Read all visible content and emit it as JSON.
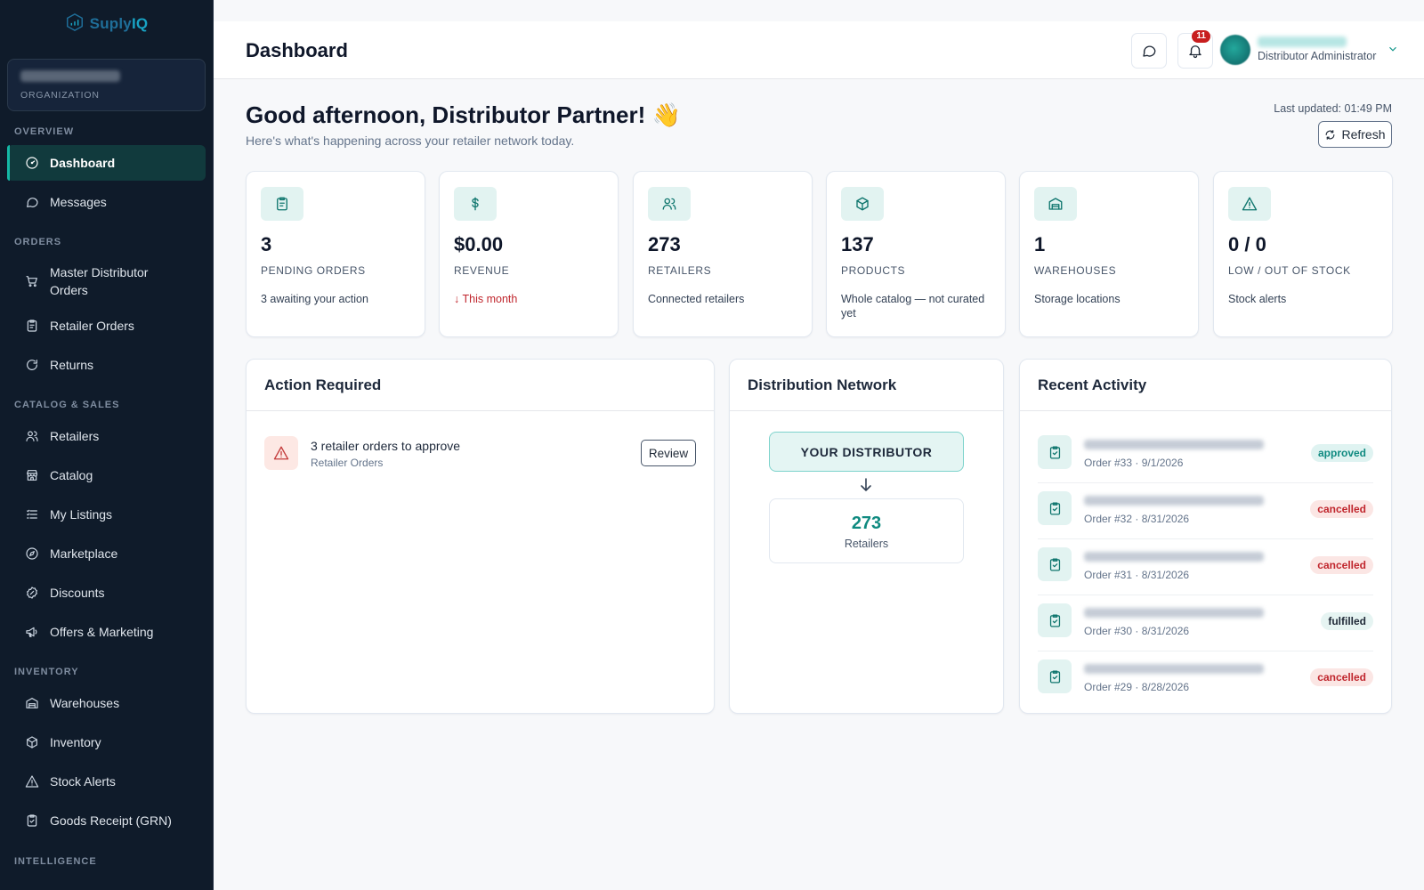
{
  "brand": {
    "name_a": "Suply",
    "name_b": "IQ"
  },
  "organization": {
    "label": "ORGANIZATION"
  },
  "sidebar": {
    "sections": [
      {
        "title": "OVERVIEW"
      },
      {
        "title": "ORDERS"
      },
      {
        "title": "CATALOG & SALES"
      },
      {
        "title": "INVENTORY"
      },
      {
        "title": "INTELLIGENCE"
      }
    ],
    "items": [
      {
        "label": "Dashboard",
        "icon": "gauge-icon"
      },
      {
        "label": "Messages",
        "icon": "chat-icon"
      },
      {
        "label": "Master Distributor Orders",
        "icon": "cart-icon"
      },
      {
        "label": "Retailer Orders",
        "icon": "clipboard-icon"
      },
      {
        "label": "Returns",
        "icon": "return-icon"
      },
      {
        "label": "Retailers",
        "icon": "users-icon"
      },
      {
        "label": "Catalog",
        "icon": "store-icon"
      },
      {
        "label": "My Listings",
        "icon": "list-icon"
      },
      {
        "label": "Marketplace",
        "icon": "compass-icon"
      },
      {
        "label": "Discounts",
        "icon": "badge-percent-icon"
      },
      {
        "label": "Offers & Marketing",
        "icon": "megaphone-icon"
      },
      {
        "label": "Warehouses",
        "icon": "warehouse-icon"
      },
      {
        "label": "Inventory",
        "icon": "box-icon"
      },
      {
        "label": "Stock Alerts",
        "icon": "alert-icon"
      },
      {
        "label": "Goods Receipt (GRN)",
        "icon": "clipboard-check-icon"
      }
    ]
  },
  "header": {
    "title": "Dashboard",
    "notification_count": "11",
    "user_role": "Distributor Administrator"
  },
  "greeting": {
    "title": "Good afternoon, Distributor Partner! 👋",
    "subtitle": "Here's what's happening across your retailer network today.",
    "last_updated": "Last updated: 01:49 PM",
    "refresh_label": "Refresh"
  },
  "stats": [
    {
      "value": "3",
      "label": "PENDING ORDERS",
      "sub": "3 awaiting your action",
      "icon": "clipboard-icon"
    },
    {
      "value": "$0.00",
      "label": "REVENUE",
      "sub": "↓ This month",
      "icon": "dollar-icon",
      "negative": true
    },
    {
      "value": "273",
      "label": "RETAILERS",
      "sub": "Connected retailers",
      "icon": "users-icon"
    },
    {
      "value": "137",
      "label": "PRODUCTS",
      "sub": "Whole catalog — not curated yet",
      "icon": "box-icon"
    },
    {
      "value": "1",
      "label": "WAREHOUSES",
      "sub": "Storage locations",
      "icon": "warehouse-icon"
    },
    {
      "value": "0 / 0",
      "label": "LOW / OUT OF STOCK",
      "sub": "Stock alerts",
      "icon": "alert-icon"
    }
  ],
  "action_required": {
    "title": "Action Required",
    "item_title": "3 retailer orders to approve",
    "item_sub": "Retailer Orders",
    "review_label": "Review"
  },
  "distribution_network": {
    "title": "Distribution Network",
    "top_label": "YOUR DISTRIBUTOR",
    "count": "273",
    "count_label": "Retailers"
  },
  "recent_activity": {
    "title": "Recent Activity",
    "items": [
      {
        "sub": "Order #33 · 9/1/2026",
        "status": "approved"
      },
      {
        "sub": "Order #32 · 8/31/2026",
        "status": "cancelled"
      },
      {
        "sub": "Order #31 · 8/31/2026",
        "status": "cancelled"
      },
      {
        "sub": "Order #30 · 8/31/2026",
        "status": "fulfilled"
      },
      {
        "sub": "Order #29 · 8/28/2026",
        "status": "cancelled"
      }
    ]
  },
  "colors": {
    "sidebar_bg": "#0f1b2a",
    "accent": "#14b8a6",
    "danger": "#c0262d"
  }
}
